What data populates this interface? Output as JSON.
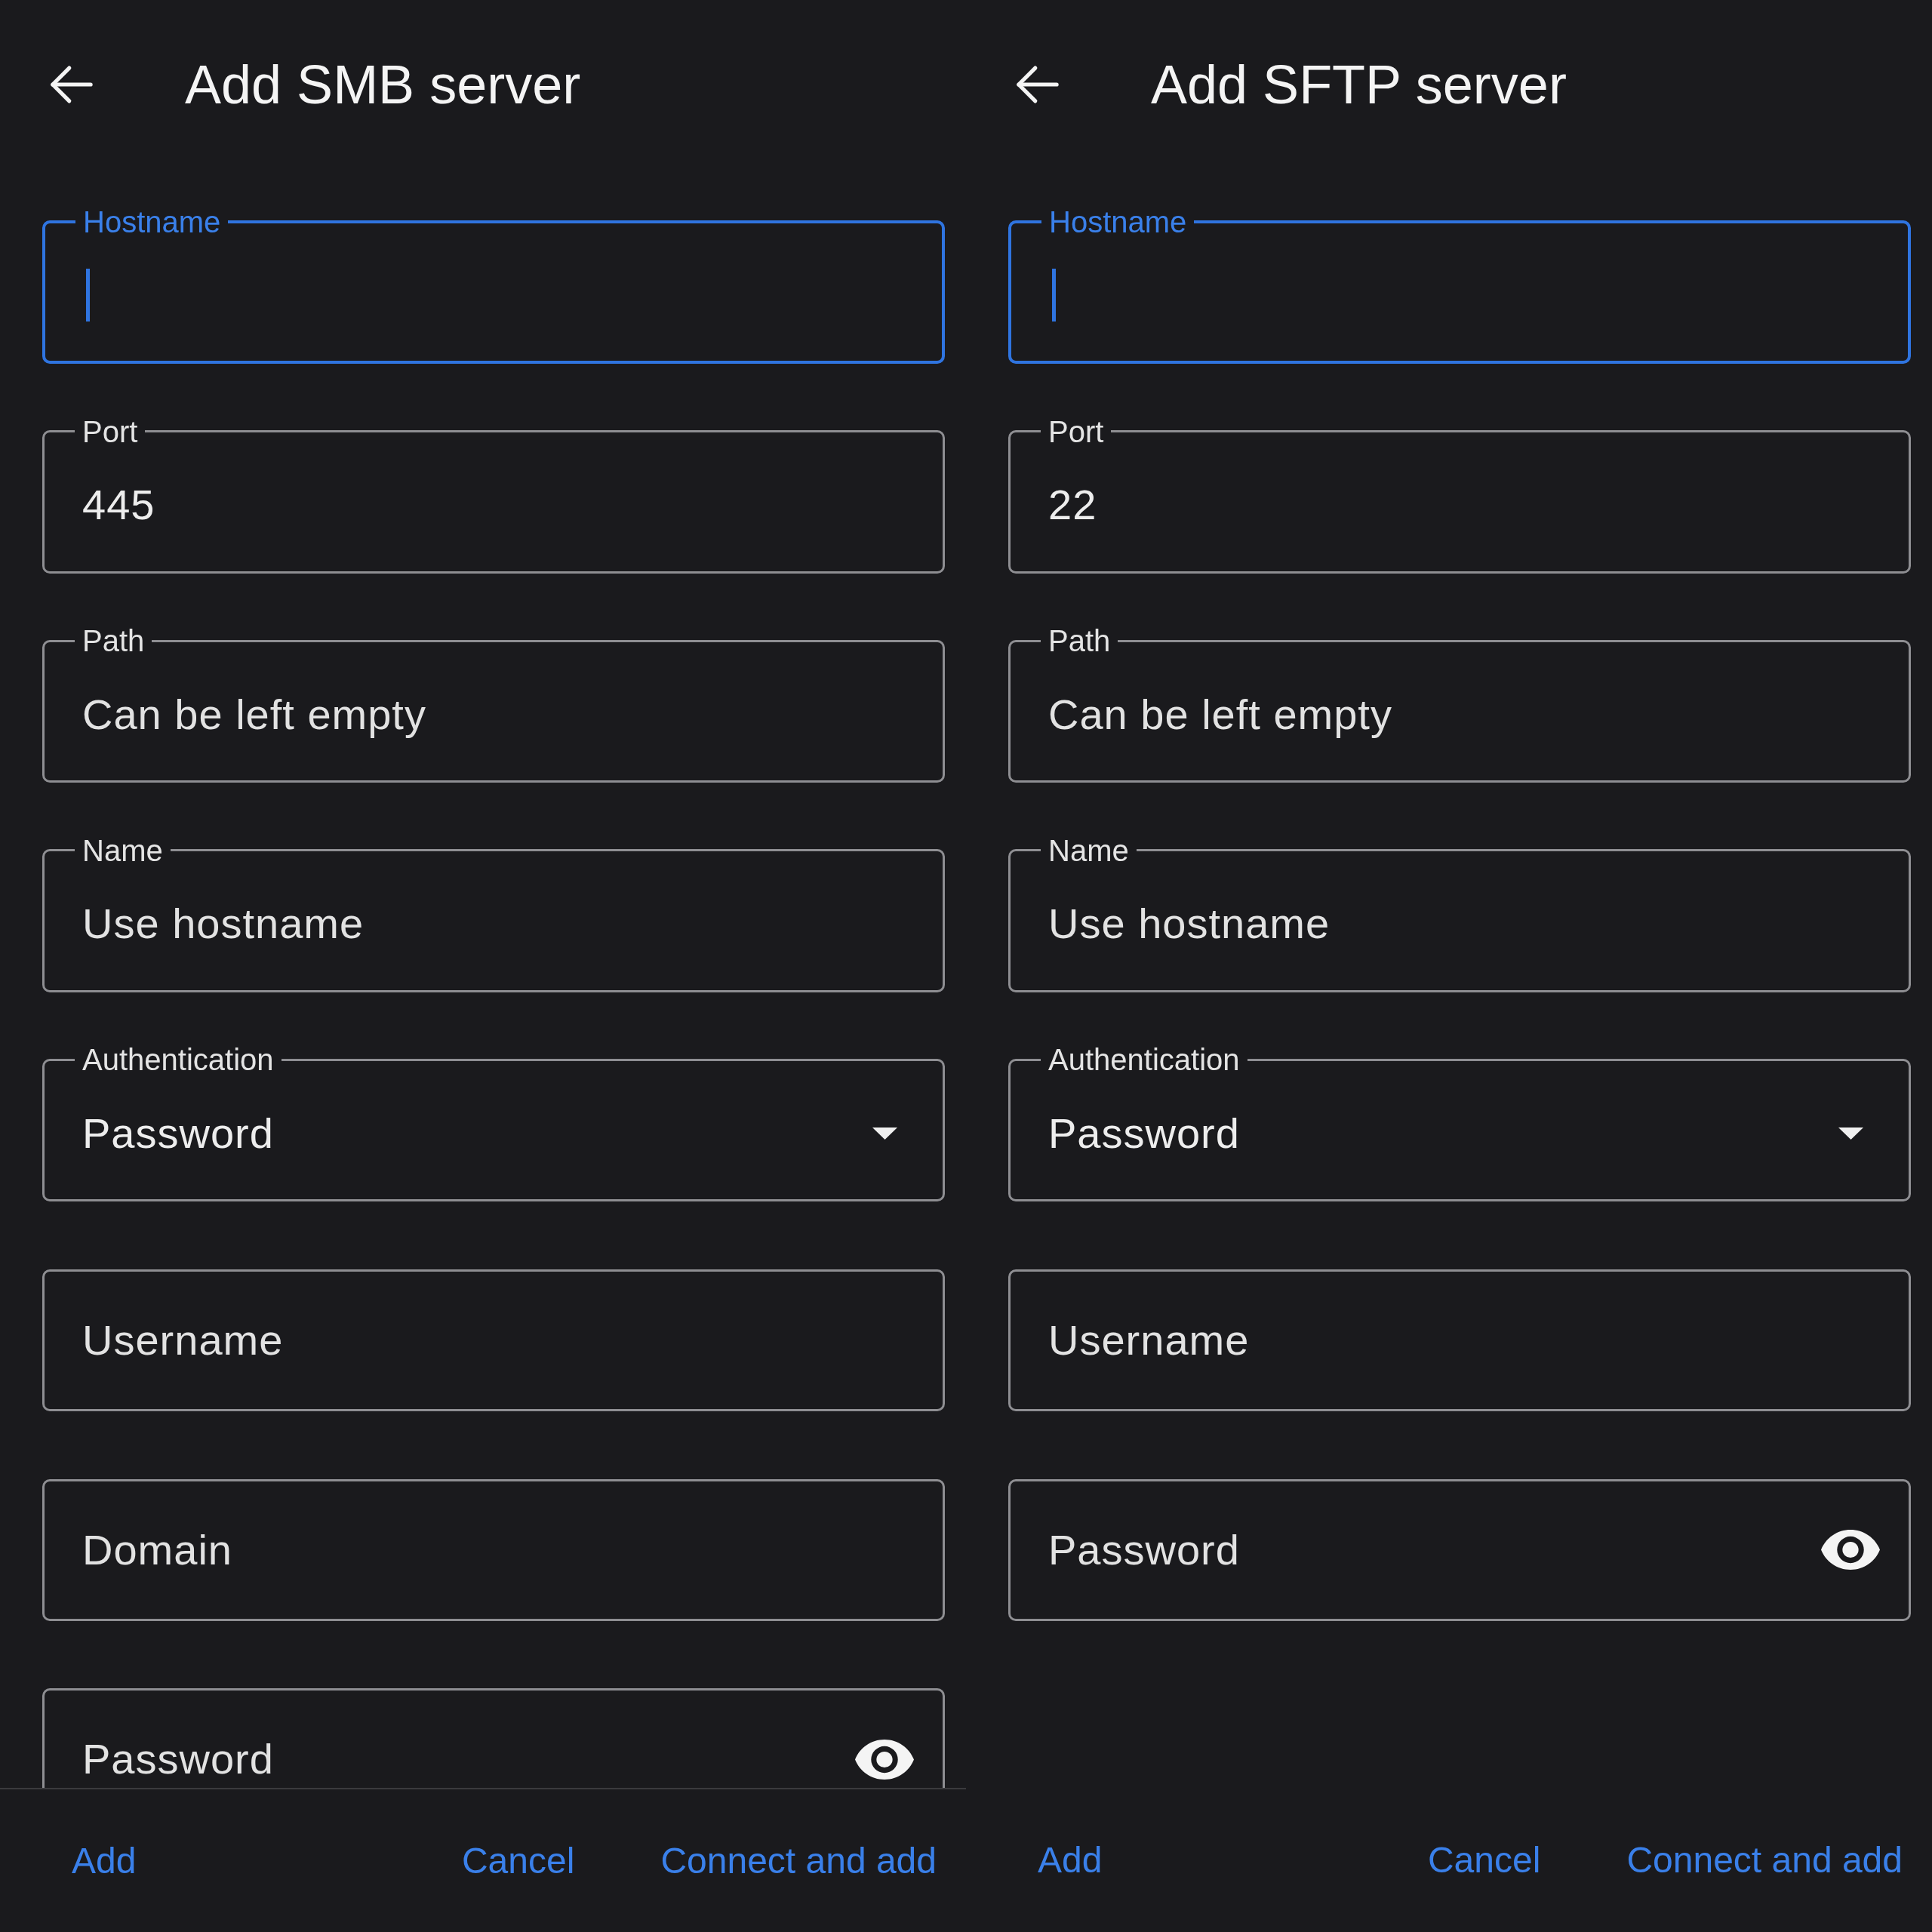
{
  "panels": [
    {
      "title": "Add SMB server",
      "scrolled": true,
      "fields": [
        {
          "kind": "text",
          "label": "Hostname",
          "focused": true
        },
        {
          "kind": "text",
          "label": "Port",
          "value": "445",
          "focused": false
        },
        {
          "kind": "text",
          "label": "Path",
          "placeholder": "Can be left empty",
          "focused": false
        },
        {
          "kind": "text",
          "label": "Name",
          "placeholder": "Use hostname",
          "focused": false
        },
        {
          "kind": "dropdown",
          "label": "Authentication",
          "value": "Password",
          "focused": false
        },
        {
          "kind": "text",
          "placeholder": "Username",
          "focused": false
        },
        {
          "kind": "text",
          "placeholder": "Domain",
          "focused": false
        },
        {
          "kind": "password",
          "placeholder": "Password",
          "focused": false
        }
      ],
      "buttons": [
        {
          "label": "Add",
          "kind": "neutral"
        },
        {
          "label": "Cancel",
          "kind": "negative"
        },
        {
          "label": "Connect and add",
          "kind": "positive"
        }
      ]
    },
    {
      "title": "Add SFTP server",
      "scrolled": false,
      "fields": [
        {
          "kind": "text",
          "label": "Hostname",
          "focused": true
        },
        {
          "kind": "text",
          "label": "Port",
          "value": "22",
          "focused": false
        },
        {
          "kind": "text",
          "label": "Path",
          "placeholder": "Can be left empty",
          "focused": false
        },
        {
          "kind": "text",
          "label": "Name",
          "placeholder": "Use hostname",
          "focused": false
        },
        {
          "kind": "dropdown",
          "label": "Authentication",
          "value": "Password",
          "focused": false
        },
        {
          "kind": "text",
          "placeholder": "Username",
          "focused": false
        },
        {
          "kind": "password",
          "placeholder": "Password",
          "focused": false
        }
      ],
      "buttons": [
        {
          "label": "Add",
          "kind": "neutral"
        },
        {
          "label": "Cancel",
          "kind": "negative"
        },
        {
          "label": "Connect and add",
          "kind": "positive"
        }
      ]
    }
  ]
}
